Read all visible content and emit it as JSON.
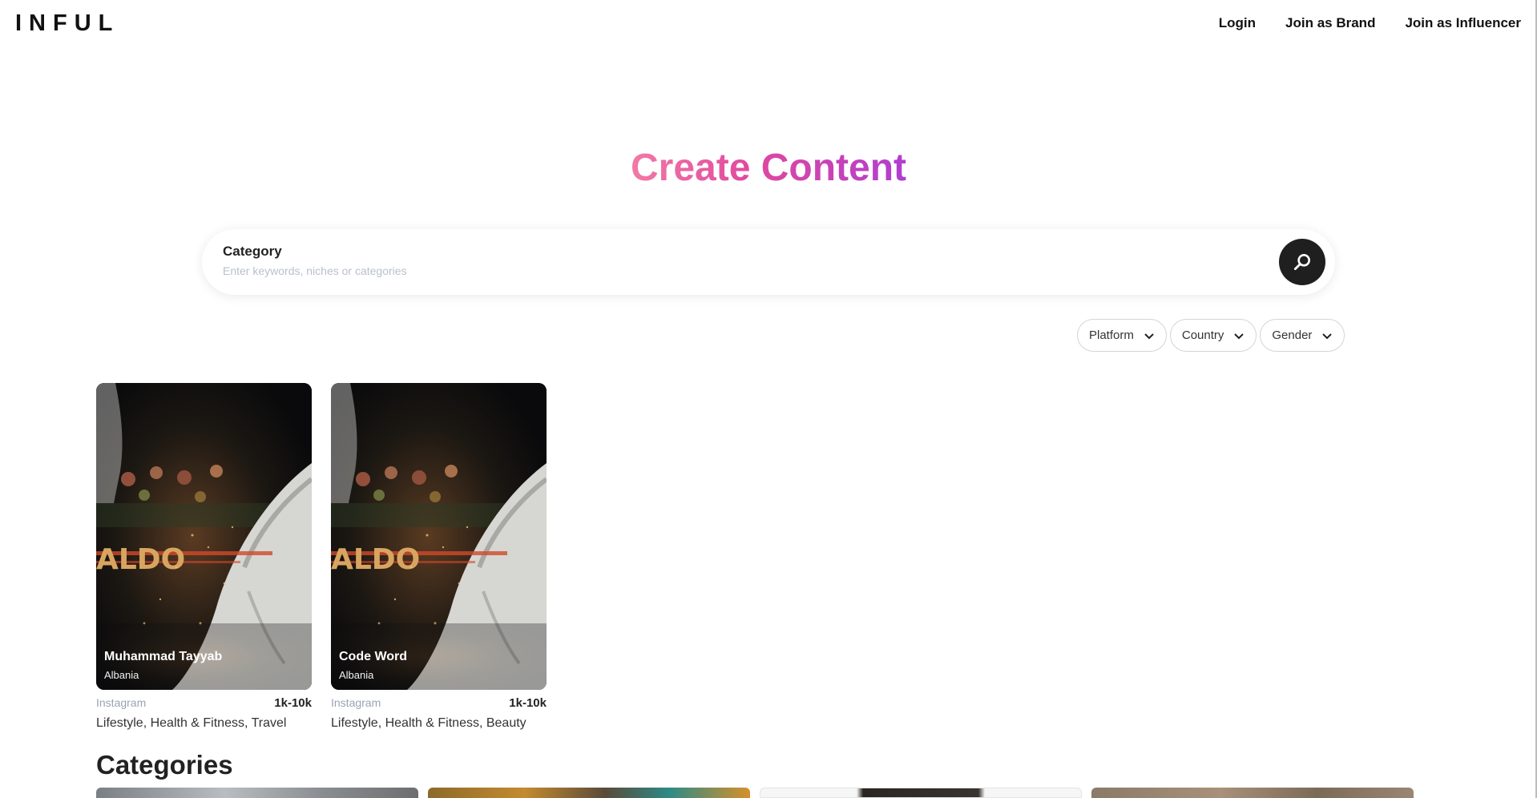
{
  "header": {
    "logo": "INFUL",
    "nav": [
      {
        "label": "Login"
      },
      {
        "label": "Join as Brand"
      },
      {
        "label": "Join as Influencer"
      }
    ]
  },
  "hero": {
    "title": "Create Content"
  },
  "search": {
    "label": "Category",
    "placeholder": "Enter keywords, niches or categories"
  },
  "filters": [
    {
      "label": "Platform"
    },
    {
      "label": "Country"
    },
    {
      "label": "Gender"
    }
  ],
  "influencers": [
    {
      "name": "Muhammad Tayyab",
      "country": "Albania",
      "platform": "Instagram",
      "followers": "1k-10k",
      "categories": "Lifestyle, Health & Fitness, Travel",
      "image_text": "ALDO"
    },
    {
      "name": "Code Word",
      "country": "Albania",
      "platform": "Instagram",
      "followers": "1k-10k",
      "categories": "Lifestyle, Health & Fitness, Beauty",
      "image_text": "ALDO"
    }
  ],
  "categories_section": {
    "title": "Categories"
  },
  "colors": {
    "gradient_start": "#f27aa6",
    "gradient_mid": "#e0489f",
    "gradient_end": "#b03ed0",
    "search_button": "#1f1f1f"
  }
}
